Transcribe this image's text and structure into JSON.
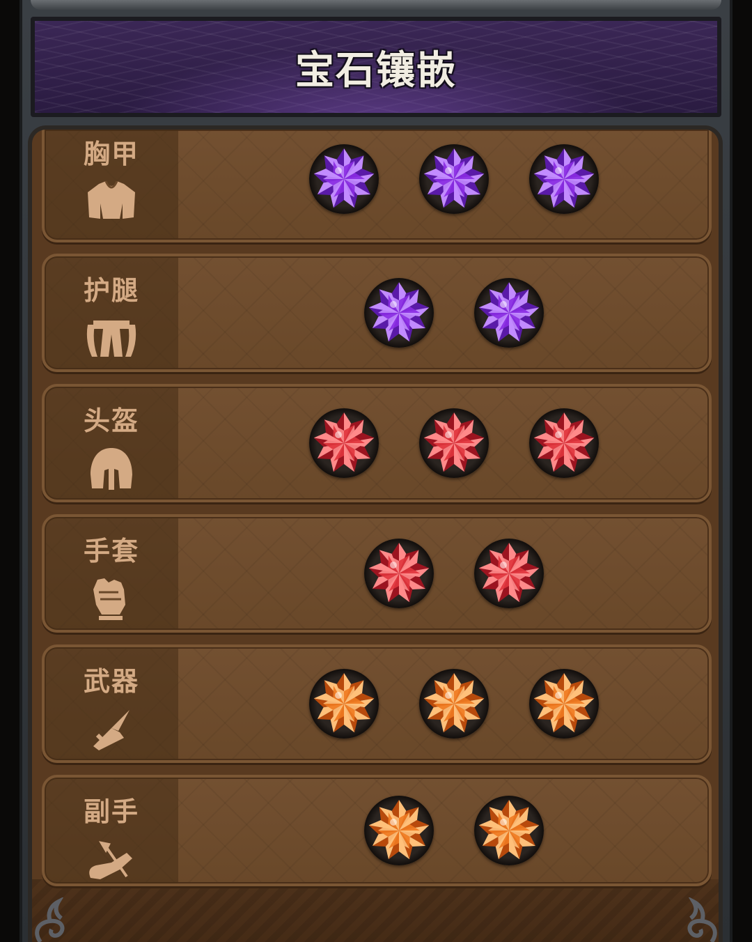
{
  "title": "宝石镶嵌",
  "colors": {
    "purple": [
      "#c28bff",
      "#8a2be2",
      "#5a1aa8"
    ],
    "red": [
      "#ff8a8a",
      "#e0343c",
      "#9c1420"
    ],
    "orange": [
      "#ffc07a",
      "#f07a20",
      "#b84a0c"
    ]
  },
  "slots": [
    {
      "label": "胸甲",
      "icon": "chest-armor-icon",
      "gem_color": "purple",
      "gem_count": 3
    },
    {
      "label": "护腿",
      "icon": "leg-armor-icon",
      "gem_color": "purple",
      "gem_count": 2
    },
    {
      "label": "头盔",
      "icon": "helmet-icon",
      "gem_color": "red",
      "gem_count": 3
    },
    {
      "label": "手套",
      "icon": "gauntlet-icon",
      "gem_color": "red",
      "gem_count": 2
    },
    {
      "label": "武器",
      "icon": "sword-icon",
      "gem_color": "orange",
      "gem_count": 3
    },
    {
      "label": "副手",
      "icon": "bow-icon",
      "gem_color": "orange",
      "gem_count": 2
    }
  ]
}
